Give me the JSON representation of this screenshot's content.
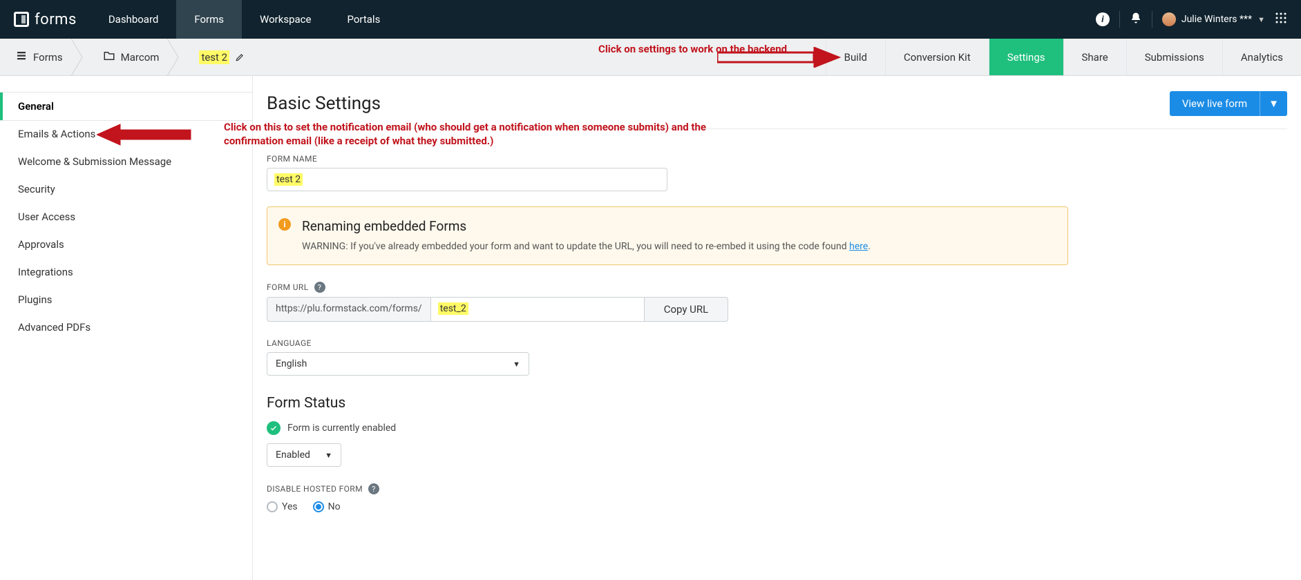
{
  "brand": "forms",
  "main_nav": [
    "Dashboard",
    "Forms",
    "Workspace",
    "Portals"
  ],
  "main_nav_active": "Forms",
  "user_name": "Julie Winters ***",
  "breadcrumbs": {
    "root": "Forms",
    "folder": "Marcom",
    "form_name": "test 2"
  },
  "sub_tabs": [
    "Build",
    "Conversion Kit",
    "Settings",
    "Share",
    "Submissions",
    "Analytics"
  ],
  "sub_tab_active": "Settings",
  "annotation_settings": "Click on settings to work on the backend",
  "sidebar": {
    "items": [
      "General",
      "Emails & Actions",
      "Welcome & Submission Message",
      "Security",
      "User Access",
      "Approvals",
      "Integrations",
      "Plugins",
      "Advanced PDFs"
    ],
    "active": "General"
  },
  "annotation_emails": "Click on this to set the notification email (who should get a notification when someone submits) and the confirmation email (like a receipt of what they submitted.)",
  "page_title": "Basic Settings",
  "view_live_label": "View live form",
  "labels": {
    "form_name": "FORM NAME",
    "form_url": "FORM URL",
    "language": "LANGUAGE",
    "disable_hosted": "DISABLE HOSTED FORM"
  },
  "form_name_value": "test 2",
  "notice": {
    "title": "Renaming embedded Forms",
    "body_prefix": "WARNING: If you've already embedded your form and want to update the URL, you will need to re-embed it using the code found ",
    "link": "here",
    "body_suffix": "."
  },
  "url": {
    "prefix": "https://plu.formstack.com/forms/",
    "slug": "test_2",
    "copy_label": "Copy URL"
  },
  "language_value": "English",
  "form_status": {
    "heading": "Form Status",
    "text": "Form is currently enabled",
    "select_value": "Enabled"
  },
  "disable_hosted": {
    "yes": "Yes",
    "no": "No",
    "value": "No"
  }
}
